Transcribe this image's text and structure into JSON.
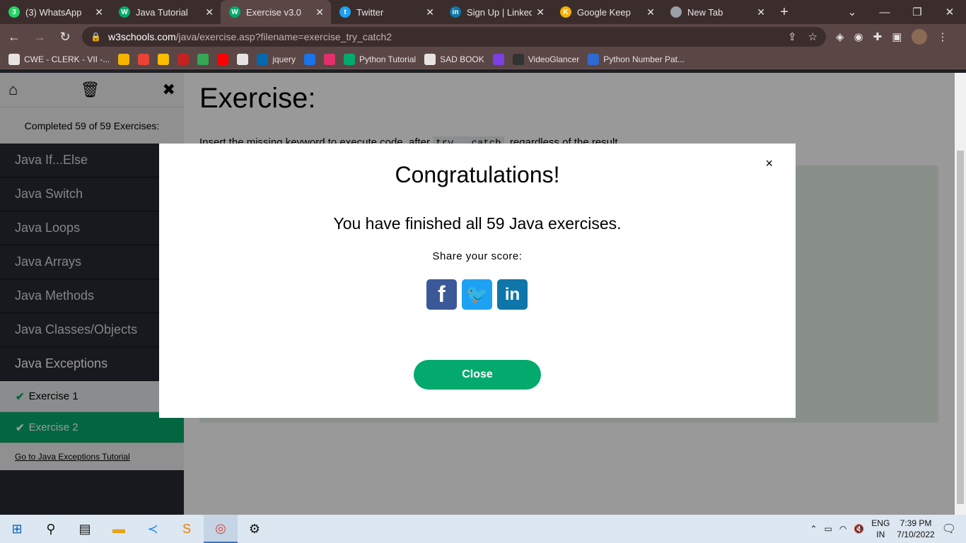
{
  "browser": {
    "tabs": [
      {
        "title": "(3) WhatsApp",
        "favicon": "whatsapp-icon",
        "color": "#25d366",
        "glyph": "3",
        "active": false
      },
      {
        "title": "Java Tutorial",
        "favicon": "w3schools-icon",
        "color": "#04aa6d",
        "glyph": "W",
        "active": false
      },
      {
        "title": "Exercise v3.0",
        "favicon": "w3schools-icon",
        "color": "#04aa6d",
        "glyph": "W",
        "active": true
      },
      {
        "title": "Twitter",
        "favicon": "twitter-icon",
        "color": "#1da1f2",
        "glyph": "t",
        "active": false
      },
      {
        "title": "Sign Up | LinkedIn",
        "favicon": "linkedin-icon",
        "color": "#0e76a8",
        "glyph": "in",
        "active": false
      },
      {
        "title": "Google Keep",
        "favicon": "keep-icon",
        "color": "#f4b400",
        "glyph": "K",
        "active": false
      },
      {
        "title": "New Tab",
        "favicon": "chrome-icon",
        "color": "#9aa0a6",
        "glyph": "",
        "active": false
      }
    ],
    "url_host": "w3schools.com",
    "url_path": "/java/exercise.asp?filename=exercise_try_catch2",
    "bookmarks": [
      {
        "label": "CWE - CLERK - VII -...",
        "color": "#e8e3e3"
      },
      {
        "label": "",
        "color": "#f4b400"
      },
      {
        "label": "",
        "color": "#ea4335"
      },
      {
        "label": "",
        "color": "#fbbc04"
      },
      {
        "label": "",
        "color": "#c5221f"
      },
      {
        "label": "",
        "color": "#34a853"
      },
      {
        "label": "",
        "color": "#ff0000"
      },
      {
        "label": "",
        "color": "#e8e3e3"
      },
      {
        "label": "jquery",
        "color": "#0769ad"
      },
      {
        "label": "",
        "color": "#1a73e8"
      },
      {
        "label": "",
        "color": "#e1306c"
      },
      {
        "label": "Python Tutorial",
        "color": "#04aa6d"
      },
      {
        "label": "SAD BOOK",
        "color": "#e8e3e3"
      },
      {
        "label": "",
        "color": "#7b3fe4"
      },
      {
        "label": "VideoGlancer",
        "color": "#333333"
      },
      {
        "label": "Python Number Pat...",
        "color": "#2d6bd1"
      }
    ]
  },
  "sidebar": {
    "status": "Completed 59 of 59 Exercises:",
    "categories": [
      "Java If...Else",
      "Java Switch",
      "Java Loops",
      "Java Arrays",
      "Java Methods",
      "Java Classes/Objects",
      "Java Exceptions"
    ],
    "exercises": [
      {
        "label": "Exercise 1",
        "active": false
      },
      {
        "label": "Exercise 2",
        "active": true
      }
    ],
    "tutorial_link": "Go to Java Exceptions Tutorial"
  },
  "main": {
    "title": "Exercise:",
    "instruction_pre": "Insert the missing keyword to execute code, after",
    "instruction_code": "try...catch",
    "instruction_post": ", regardless of the result."
  },
  "modal": {
    "title": "Congratulations!",
    "message": "You have finished all 59 Java exercises.",
    "share": "Share your score:",
    "close_x": "×",
    "close_button": "Close"
  },
  "taskbar": {
    "lang_top": "ENG",
    "lang_bottom": "IN",
    "time": "7:39 PM",
    "date": "7/10/2022"
  }
}
